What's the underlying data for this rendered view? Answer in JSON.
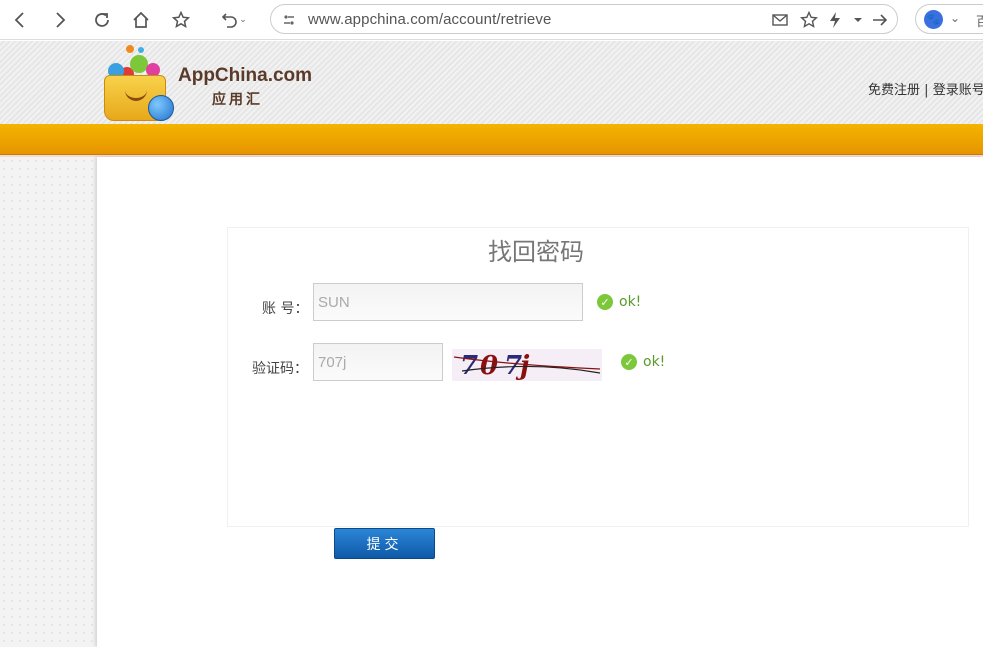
{
  "browser": {
    "url": "www.appchina.com/account/retrieve",
    "search_engine_text": "百"
  },
  "header": {
    "logo_text": "AppChina.com",
    "logo_cn": "应用汇",
    "register_link": "免费注册",
    "separator": "|",
    "login_link": "登录账号"
  },
  "form": {
    "title": "找回密码",
    "account_label": "账  号：",
    "account_value": "SUN",
    "captcha_label": "验证码：",
    "captcha_value": "707j",
    "captcha_chars": [
      "7",
      "0",
      "7",
      "j"
    ],
    "ok_text": "ok!",
    "submit_label": "提交"
  },
  "colors": {
    "orange_band": "#f0a800",
    "submit_button": "#1565b8",
    "ok_green": "#5a9a2a"
  }
}
